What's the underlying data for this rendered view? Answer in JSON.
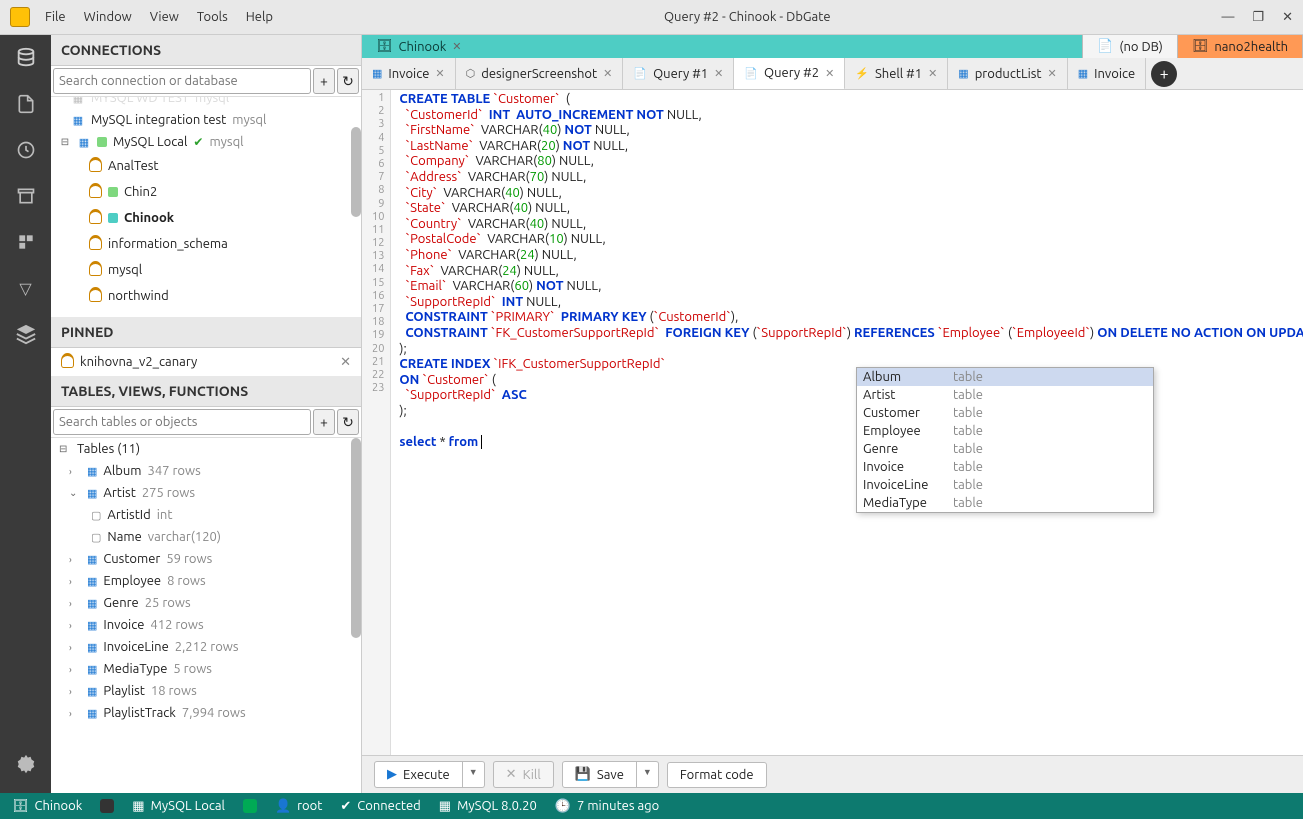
{
  "window": {
    "title": "Query #2 - Chinook - DbGate",
    "menu": [
      "File",
      "Window",
      "View",
      "Tools",
      "Help"
    ]
  },
  "panels": {
    "connections_hdr": "CONNECTIONS",
    "search_conn_ph": "Search connection or database",
    "pinned_hdr": "PINNED",
    "tables_hdr": "TABLES, VIEWS, FUNCTIONS",
    "search_tbl_ph": "Search tables or objects"
  },
  "conn_tree": {
    "hidden_top": {
      "name": "MYSQL WD TEST",
      "type": "mysql"
    },
    "int_test": {
      "name": "MySQL integration test",
      "type": "mysql"
    },
    "local": {
      "name": "MySQL Local",
      "type": "mysql"
    },
    "dbs": {
      "analtest": "AnalTest",
      "chin2": "Chin2",
      "chinook": "Chinook",
      "info": "information_schema",
      "mysql": "mysql",
      "northwind": "northwind"
    }
  },
  "pinned": {
    "item": "knihovna_v2_canary"
  },
  "tables_section": {
    "header": "Tables (11)",
    "items": [
      {
        "name": "Album",
        "cnt": "347 rows"
      },
      {
        "name": "Artist",
        "cnt": "275 rows",
        "open": true,
        "cols": [
          {
            "name": "ArtistId",
            "type": "int"
          },
          {
            "name": "Name",
            "type": "varchar(120)"
          }
        ]
      },
      {
        "name": "Customer",
        "cnt": "59 rows"
      },
      {
        "name": "Employee",
        "cnt": "8 rows"
      },
      {
        "name": "Genre",
        "cnt": "25 rows"
      },
      {
        "name": "Invoice",
        "cnt": "412 rows"
      },
      {
        "name": "InvoiceLine",
        "cnt": "2,212 rows"
      },
      {
        "name": "MediaType",
        "cnt": "5 rows"
      },
      {
        "name": "Playlist",
        "cnt": "18 rows"
      },
      {
        "name": "PlaylistTrack",
        "cnt": "7,994 rows"
      }
    ]
  },
  "ctx_tabs": [
    {
      "label": "Chinook",
      "active": true,
      "closable": true
    },
    {
      "label": "(no DB)",
      "closable": false
    },
    {
      "label": "nano2health",
      "orange": true
    }
  ],
  "file_tabs": [
    {
      "label": "Invoice",
      "icon": "grid"
    },
    {
      "label": "designerScreenshot",
      "icon": "dia"
    },
    {
      "label": "Query #1",
      "icon": "doc"
    },
    {
      "label": "Query #2",
      "icon": "doc",
      "active": true
    },
    {
      "label": "Shell #1",
      "icon": "bolt"
    },
    {
      "label": "productList",
      "icon": "grid"
    },
    {
      "label": "Invoice",
      "icon": "grid",
      "noclose": true
    }
  ],
  "autocomplete": [
    {
      "name": "Album",
      "type": "table",
      "sel": true
    },
    {
      "name": "Artist",
      "type": "table"
    },
    {
      "name": "Customer",
      "type": "table"
    },
    {
      "name": "Employee",
      "type": "table"
    },
    {
      "name": "Genre",
      "type": "table"
    },
    {
      "name": "Invoice",
      "type": "table"
    },
    {
      "name": "InvoiceLine",
      "type": "table"
    },
    {
      "name": "MediaType",
      "type": "table"
    }
  ],
  "bottom": {
    "execute": "Execute",
    "kill": "Kill",
    "save": "Save",
    "format": "Format code"
  },
  "status": {
    "db": "Chinook",
    "server": "MySQL Local",
    "user": "root",
    "state": "Connected",
    "version": "MySQL 8.0.20",
    "time": "7 minutes ago"
  }
}
